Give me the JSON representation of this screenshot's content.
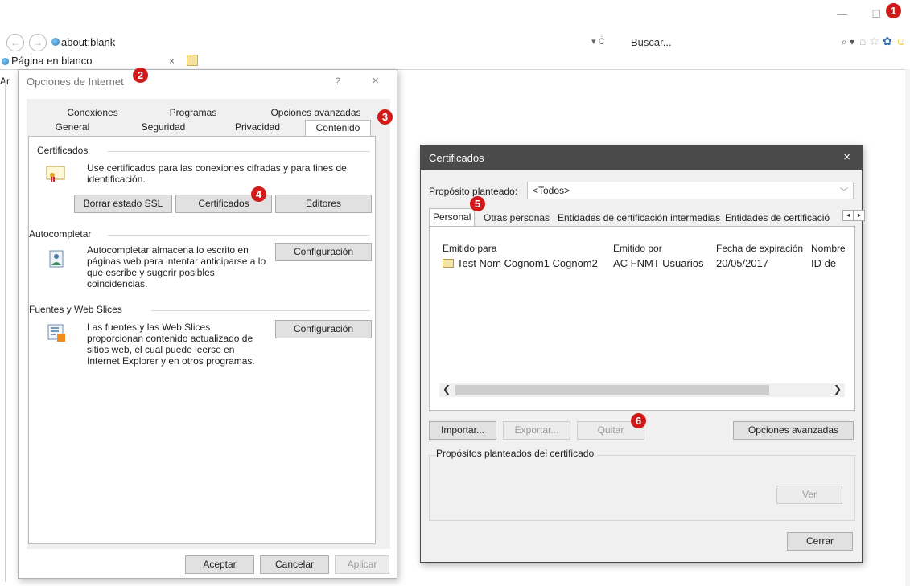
{
  "browser": {
    "address": "about:blank",
    "search_placeholder": "Buscar...",
    "search_dropdown": "⌕ ▾",
    "refresh_glyph": "▾ Ċ",
    "tab_title": "Página en blanco",
    "tab_close": "×",
    "page_text_fragment": "Ar"
  },
  "callouts": [
    "1",
    "2",
    "3",
    "4",
    "5",
    "6"
  ],
  "internet_options": {
    "title": "Opciones de Internet",
    "help": "?",
    "close": "×",
    "tabs_row_back": [
      "Conexiones",
      "Programas",
      "Opciones avanzadas"
    ],
    "tabs_row_front": [
      "General",
      "Seguridad",
      "Privacidad",
      "Contenido"
    ],
    "certificates": {
      "title": "Certificados",
      "description": "Use certificados para las conexiones cifradas y para fines de identificación.",
      "buttons": [
        "Borrar estado SSL",
        "Certificados",
        "Editores"
      ]
    },
    "autocomplete": {
      "title": "Autocompletar",
      "description": "Autocompletar almacena lo escrito en páginas web para intentar anticiparse a lo que escribe y sugerir posibles coincidencias.",
      "button": "Configuración"
    },
    "feeds": {
      "title": "Fuentes y Web Slices",
      "description": "Las fuentes y las Web Slices proporcionan contenido actualizado de sitios web, el cual puede leerse en Internet Explorer y en otros programas.",
      "button": "Configuración"
    },
    "footer": {
      "ok": "Aceptar",
      "cancel": "Cancelar",
      "apply": "Aplicar"
    }
  },
  "certificados": {
    "title": "Certificados",
    "close": "×",
    "purpose_label": "Propósito planteado:",
    "purpose_value": "<Todos>",
    "tabs": [
      "Personal",
      "Otras personas",
      "Entidades de certificación intermedias",
      "Entidades de certificació"
    ],
    "columns": [
      "Emitido para",
      "Emitido por",
      "Fecha de expiración",
      "Nombre"
    ],
    "rows": [
      {
        "issued_to": "Test Nom Cognom1 Cognom2",
        "issued_by": "AC FNMT Usuarios",
        "expiry": "20/05/2017",
        "name": "ID de"
      }
    ],
    "buttons": {
      "import": "Importar...",
      "export": "Exportar...",
      "remove": "Quitar",
      "advanced": "Opciones avanzadas"
    },
    "purposes_title": "Propósitos planteados del certificado",
    "view": "Ver",
    "close_button": "Cerrar"
  }
}
